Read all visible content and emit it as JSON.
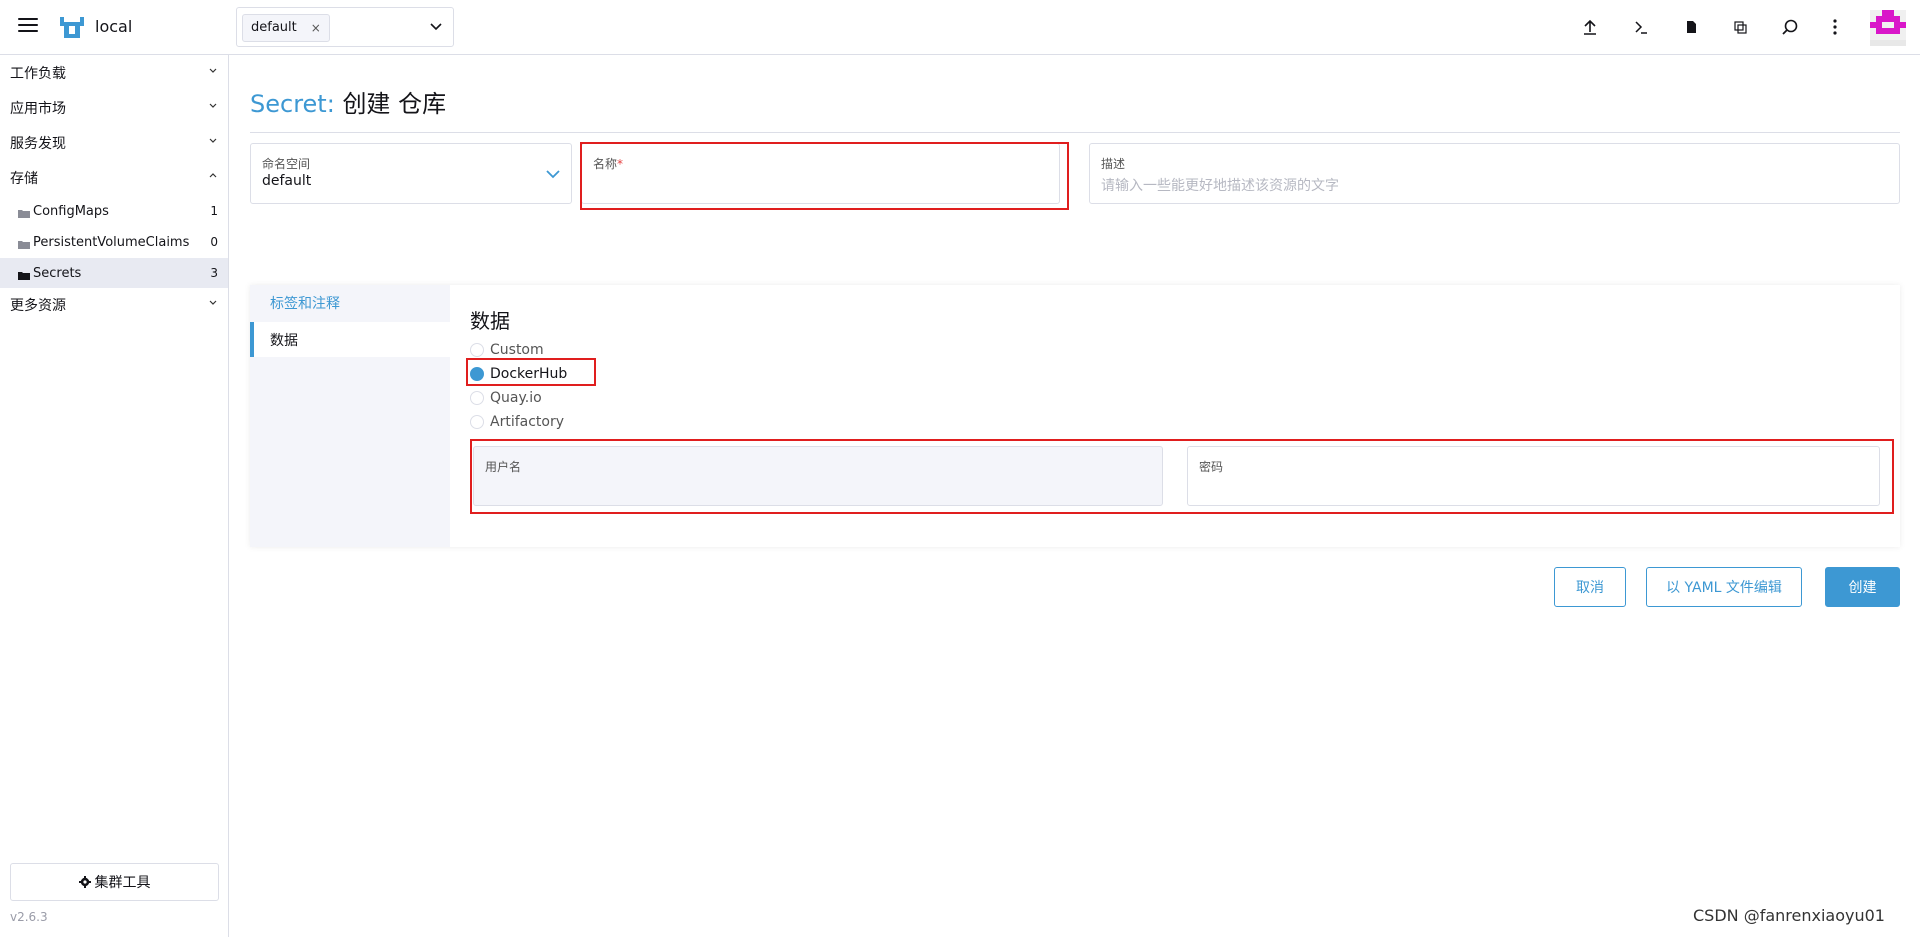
{
  "header": {
    "cluster_name": "local",
    "namespace_chip": "default",
    "chip_remove": "×",
    "icons": [
      "menu-icon",
      "upload-icon",
      "terminal-icon",
      "file-icon",
      "copy-icon",
      "search-icon",
      "more-vertical-icon"
    ]
  },
  "sidebar": {
    "groups": [
      {
        "label": "工作负载"
      },
      {
        "label": "应用市场"
      },
      {
        "label": "服务发现"
      },
      {
        "label": "存储"
      },
      {
        "label": "更多资源"
      }
    ],
    "storage_items": [
      {
        "label": "ConfigMaps",
        "count": "1"
      },
      {
        "label": "PersistentVolumeClaims",
        "count": "0"
      },
      {
        "label": "Secrets",
        "count": "3"
      }
    ],
    "cluster_tools": "集群工具",
    "version": "v2.6.3"
  },
  "page": {
    "resource_type": "Secret:",
    "title": "创建 仓库"
  },
  "form": {
    "namespace_label": "命名空间",
    "namespace_value": "default",
    "name_label": "名称",
    "required_mark": "*",
    "description_label": "描述",
    "description_placeholder": "请输入一些能更好地描述该资源的文字"
  },
  "tabs": [
    {
      "label": "标签和注释"
    },
    {
      "label": "数据"
    }
  ],
  "data_section": {
    "title": "数据",
    "registry_options": [
      "Custom",
      "DockerHub",
      "Quay.io",
      "Artifactory"
    ],
    "selected": "DockerHub",
    "username_label": "用户名",
    "password_label": "密码"
  },
  "actions": {
    "cancel": "取消",
    "edit_yaml": "以 YAML 文件编辑",
    "create": "创建"
  },
  "watermark": "CSDN @fanrenxiaoyu01",
  "colors": {
    "accent": "#3d98d3",
    "highlight_box": "#e01e1e",
    "avatar": "#d916c9"
  }
}
